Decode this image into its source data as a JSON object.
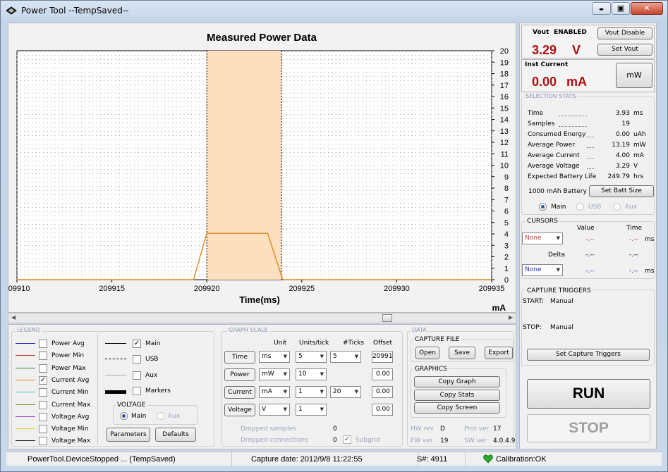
{
  "window": {
    "title": "Power Tool --TempSaved--",
    "min": "▬",
    "max": "▣",
    "close": "✕"
  },
  "chart_data": {
    "type": "line",
    "title": "Measured Power Data",
    "xlabel": "Time(ms)",
    "ylabel": "mA",
    "xlim": [
      209910,
      209935
    ],
    "ylim": [
      0,
      20
    ],
    "x_ticks": [
      "209910",
      "209915",
      "209920",
      "209925",
      "209930",
      "209935"
    ],
    "x_tick_values": [
      209910,
      209915,
      209920,
      209925,
      209930,
      209935
    ],
    "y_ticks": [
      "0",
      "1",
      "2",
      "3",
      "4",
      "5",
      "6",
      "7",
      "8",
      "9",
      "10",
      "11",
      "12",
      "13",
      "14",
      "15",
      "16",
      "17",
      "18",
      "19",
      "20"
    ],
    "grid": true,
    "selection": [
      209920,
      209923.93
    ],
    "series": [
      {
        "name": "Current Avg",
        "color": "#e08a1e",
        "x": [
          209910,
          209919.3,
          209920,
          209923.2,
          209924,
          209935
        ],
        "y": [
          0,
          0,
          4.05,
          4.05,
          0,
          0
        ]
      }
    ]
  },
  "legend": {
    "label": "LEGEND",
    "items": [
      {
        "label": "Power Avg",
        "color": "#1f2fb5",
        "checked": false,
        "mark": ""
      },
      {
        "label": "Power Min",
        "color": "#c0392b",
        "checked": false,
        "mark": ""
      },
      {
        "label": "Power Max",
        "color": "#2e8b2e",
        "checked": false,
        "mark": ""
      },
      {
        "label": "Current Avg",
        "color": "#e08a1e",
        "checked": true,
        "mark": "✓"
      },
      {
        "label": "Current Min",
        "color": "#3fc1c9",
        "checked": false,
        "mark": ""
      },
      {
        "label": "Current Max",
        "color": "#7a8a2a",
        "checked": false,
        "mark": ""
      },
      {
        "label": "Voltage Avg",
        "color": "#8e3fb5",
        "checked": false,
        "mark": ""
      },
      {
        "label": "Voltage Min",
        "color": "#e6d11e",
        "checked": false,
        "mark": ""
      },
      {
        "label": "Voltage Max",
        "color": "#111111",
        "checked": false,
        "mark": ""
      }
    ],
    "channels": [
      {
        "label": "Main",
        "checked": true,
        "mark": "✓"
      },
      {
        "label": "USB",
        "checked": false,
        "mark": ""
      },
      {
        "label": "Aux",
        "checked": false,
        "mark": ""
      },
      {
        "label": "Markers",
        "checked": false,
        "mark": ""
      }
    ],
    "voltage_label": "VOLTAGE",
    "voltage_main": "Main",
    "voltage_aux": "Aux",
    "parameters_btn": "Parameters",
    "defaults_btn": "Defaults"
  },
  "graph_scale": {
    "label": "GRAPH SCALE",
    "headers": {
      "unit": "Unit",
      "units_tick": "Units/tick",
      "ticks": "#Ticks",
      "offset": "Offset"
    },
    "rows": [
      {
        "name": "Time",
        "unit": "ms",
        "per_tick": "5",
        "ticks": "5",
        "offset": "20991"
      },
      {
        "name": "Power",
        "unit": "mW",
        "per_tick": "10",
        "ticks": "",
        "offset": "0.00"
      },
      {
        "name": "Current",
        "unit": "mA",
        "per_tick": "1",
        "ticks": "20",
        "offset": "0.00"
      },
      {
        "name": "Voltage",
        "unit": "V",
        "per_tick": "1",
        "ticks": "",
        "offset": "0.00"
      }
    ],
    "dropped_samples": "Dropped samples",
    "dropped_samples_val": "0",
    "dropped_connections": "Dropped connections",
    "dropped_connections_val": "0",
    "subgrid": "Subgrid"
  },
  "data": {
    "label": "DATA",
    "capture_file": "CAPTURE FILE",
    "open": "Open",
    "save": "Save",
    "export": "Export",
    "graphics": "GRAPHICS",
    "copy_graph": "Copy Graph",
    "copy_stats": "Copy Stats",
    "copy_screen": "Copy Screen",
    "hw_rev_label": "HW rev",
    "hw_rev": "D",
    "prot_ver_label": "Prot ver",
    "prot_ver": "17",
    "fw_ver_label": "FW ver",
    "fw_ver": "19",
    "sw_ver_label": "SW ver",
    "sw_ver": "4.0.4.9"
  },
  "vout": {
    "label": "Vout",
    "enabled": "ENABLED",
    "value": "3.29",
    "unit": "V",
    "disable_btn": "Vout Disable",
    "set_btn": "Set Vout"
  },
  "inst": {
    "label": "Inst Current",
    "value": "0.00",
    "unit": "mA",
    "btn": "mW"
  },
  "stats": {
    "label": "SELECTION STATS",
    "rows": [
      {
        "name": "Time",
        "value": "3.93",
        "unit": "ms"
      },
      {
        "name": "Samples",
        "value": "19",
        "unit": ""
      },
      {
        "name": "Consumed Energy",
        "value": "0.00",
        "unit": "uAh"
      },
      {
        "name": "Average Power",
        "value": "13.19",
        "unit": "mW"
      },
      {
        "name": "Average Current",
        "value": "4.00",
        "unit": "mA"
      },
      {
        "name": "Average Voltage",
        "value": "3.29",
        "unit": "V"
      },
      {
        "name": "Expected Battery Life",
        "value": "249.79",
        "unit": "hrs"
      }
    ],
    "batt_value": "1000",
    "batt_label": "mAh Battery",
    "set_batt_btn": "Set Batt Size",
    "main": "Main",
    "usb": "USB",
    "aux": "Aux"
  },
  "cursors": {
    "label": "CURSORS",
    "value": "Value",
    "time": "Time",
    "c1": "None",
    "c1_value": "-.--",
    "c1_time": "-.--",
    "ms": "ms",
    "delta": "Delta",
    "delta_value": "-.--",
    "delta_time": "-.--",
    "c2": "None",
    "c2_value": "-.--",
    "c2_time": "-.--"
  },
  "triggers": {
    "label": "CAPTURE TRIGGERS",
    "start_label": "START:",
    "start": "Manual",
    "stop_label": "STOP:",
    "stop": "Manual",
    "btn": "Set Capture Triggers"
  },
  "run_btn": "RUN",
  "stop_btn": "STOP",
  "status": {
    "device": "PowerTool.DeviceStopped ... (TempSaved)",
    "capture_date": "Capture date: 2012/9/8 11:22:55",
    "serial": "S#: 4911",
    "calibration": "Calibration:OK"
  }
}
